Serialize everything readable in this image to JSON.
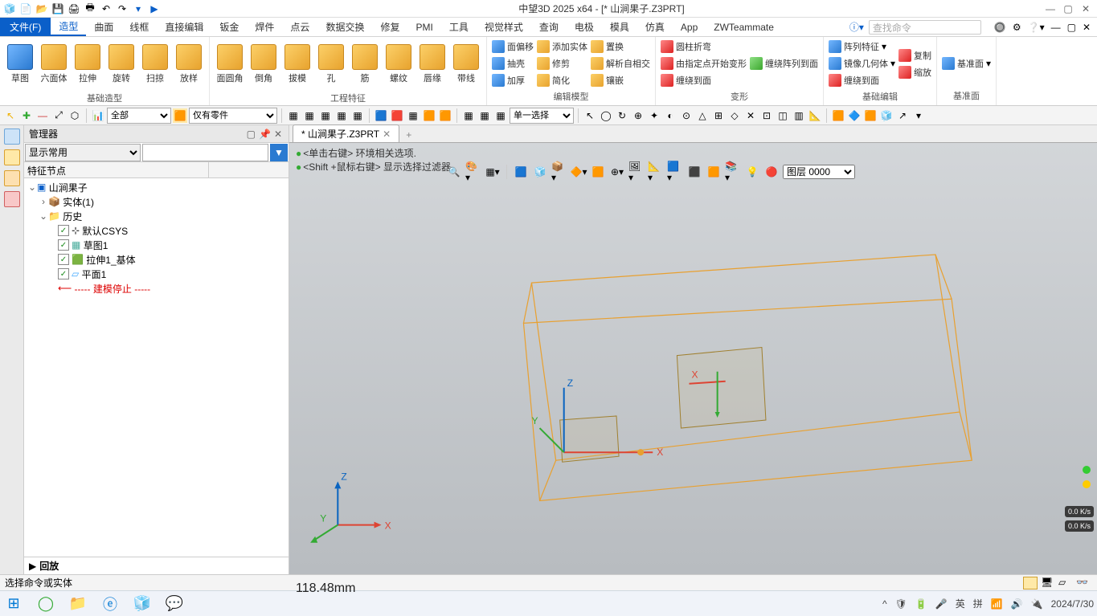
{
  "title": "中望3D 2025 x64 - [* 山涧果子.Z3PRT]",
  "qat_icons": [
    "app-icon",
    "new-icon",
    "open-icon",
    "save-icon",
    "print-icon",
    "print-preview-icon",
    "undo-icon",
    "redo-icon",
    "arrow-icon",
    "play-icon"
  ],
  "menubar": {
    "file": "文件(F)",
    "tabs": [
      "造型",
      "曲面",
      "线框",
      "直接编辑",
      "钣金",
      "焊件",
      "点云",
      "数据交换",
      "修复",
      "PMI",
      "工具",
      "视觉样式",
      "查询",
      "电极",
      "模具",
      "仿真",
      "App",
      "ZWTeammate"
    ],
    "active_tab": "造型",
    "search_placeholder": "查找命令"
  },
  "ribbon": {
    "basic": {
      "label": "基础造型",
      "btns": [
        "草图",
        "六面体",
        "拉伸",
        "旋转",
        "扫掠",
        "放样"
      ]
    },
    "eng": {
      "label": "工程特征",
      "btns": [
        "面圆角",
        "倒角",
        "拔模",
        "孔",
        "筋",
        "螺纹",
        "唇缘",
        "带线"
      ]
    },
    "edit": {
      "label": "编辑模型",
      "cols": [
        [
          "面偏移",
          "抽壳",
          "加厚"
        ],
        [
          "添加实体",
          "修剪",
          "简化"
        ],
        [
          "置换",
          "解析自相交",
          "镶嵌"
        ]
      ]
    },
    "deform": {
      "label": "变形",
      "items": [
        "圆柱折弯",
        "由指定点开始变形",
        "缠绕到面",
        "缠绕阵列到面"
      ]
    },
    "base_edit": {
      "label": "基础编辑",
      "cols": [
        [
          "阵列特征",
          "镜像几何体",
          "缠绕到面"
        ],
        [
          "复制",
          "缩放"
        ]
      ]
    },
    "datum": {
      "label": "基准面",
      "btn": "基准面"
    }
  },
  "toolbar2": {
    "filter1": "全部",
    "filter2": "仅有零件",
    "sel_mode": "单一选择"
  },
  "manager": {
    "title": "管理器",
    "display": "显示常用",
    "col1": "特征节点",
    "root": "山涧果子",
    "entity": "实体(1)",
    "history": "历史",
    "nodes": [
      "默认CSYS",
      "草图1",
      "拉伸1_基体",
      "平面1"
    ],
    "stop": "----- 建模停止 -----",
    "playback": "回放"
  },
  "view": {
    "tab": "* 山涧果子.Z3PRT",
    "hint1": "<单击右键> 环境相关选项.",
    "hint2": "<Shift +鼠标右键> 显示选择过滤器.",
    "layer": "图层 0000",
    "dimension": "118.48mm"
  },
  "statusbar": {
    "text": "选择命令或实体"
  },
  "taskbar": {
    "date": "2024/7/30",
    "lang1": "英",
    "lang2": "拼"
  },
  "meters": [
    "0.0\nK/s",
    "0.0\nK/s"
  ]
}
